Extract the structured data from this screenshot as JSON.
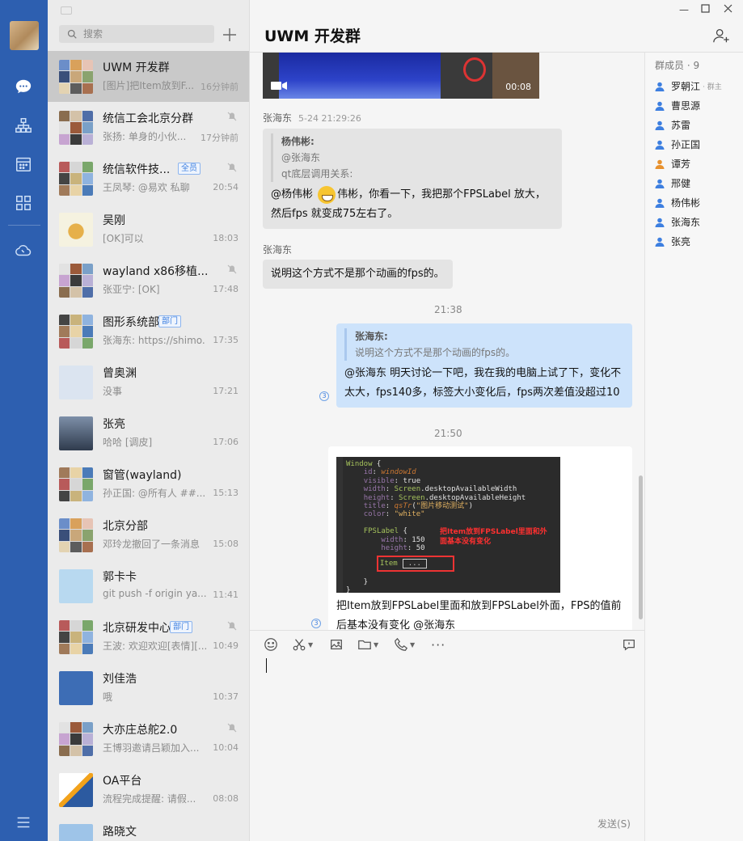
{
  "search": {
    "placeholder": "搜索"
  },
  "conversations": [
    {
      "name": "UWM 开发群",
      "preview": "[图片]把Item放到F...",
      "time": "16分钟前",
      "muted": false,
      "badge": ""
    },
    {
      "name": "统信工会北京分群",
      "preview": "张扬: 单身的小伙...",
      "time": "17分钟前",
      "muted": true,
      "badge": ""
    },
    {
      "name": "统信软件技...",
      "preview": "王凤琴: @易欢 私聊",
      "time": "20:54",
      "muted": true,
      "badge": "全员"
    },
    {
      "name": "吴刚",
      "preview": "[OK]可以",
      "time": "18:03",
      "muted": false,
      "badge": ""
    },
    {
      "name": "wayland  x86移植...",
      "preview": "张亚宁: [OK]",
      "time": "17:48",
      "muted": true,
      "badge": ""
    },
    {
      "name": "图形系统部",
      "preview": "张海东: https://shimo...",
      "time": "17:35",
      "muted": false,
      "badge": "部门"
    },
    {
      "name": "曾奥渊",
      "preview": "没事",
      "time": "17:21",
      "muted": false,
      "badge": ""
    },
    {
      "name": "张亮",
      "preview": "哈哈 [调皮]",
      "time": "17:06",
      "muted": false,
      "badge": ""
    },
    {
      "name": "窗管(wayland)",
      "preview": "孙正国: @所有人  ##...",
      "time": "15:13",
      "muted": false,
      "badge": ""
    },
    {
      "name": "北京分部",
      "preview": "邓玲龙撤回了一条消息",
      "time": "15:08",
      "muted": false,
      "badge": ""
    },
    {
      "name": "郭卡卡",
      "preview": "git push -f origin ya...",
      "time": "11:41",
      "muted": false,
      "badge": ""
    },
    {
      "name": "北京研发中心",
      "preview": "王波: 欢迎欢迎[表情][...",
      "time": "10:49",
      "muted": true,
      "badge": "部门"
    },
    {
      "name": "刘佳浩",
      "preview": "哦",
      "time": "10:37",
      "muted": false,
      "badge": ""
    },
    {
      "name": "大亦庄总舵2.0",
      "preview": "王博羽邀请吕颖加入...",
      "time": "10:04",
      "muted": true,
      "badge": ""
    },
    {
      "name": "OA平台",
      "preview": "流程完成提醒:  请假...",
      "time": "08:08",
      "muted": false,
      "badge": ""
    },
    {
      "name": "路晓文",
      "preview": "",
      "time": "",
      "muted": false,
      "badge": ""
    }
  ],
  "chat": {
    "title": "UWM 开发群",
    "video_duration": "00:08",
    "msg1": {
      "sender": "张海东",
      "time": "5-24 21:29:26",
      "quote_author": "杨伟彬:",
      "quote_line1": "@张海东",
      "quote_line2": "qt底层调用关系:",
      "text_a": "@杨伟彬 ",
      "text_b": "伟彬，你看一下，我把那个FPSLabel 放大，然后fps 就变成75左右了。"
    },
    "msg2": {
      "sender": "张海东",
      "text": "说明这个方式不是那个动画的fps的。"
    },
    "ts1": "21:38",
    "msg3": {
      "quote_author": "张海东:",
      "quote_text": "说明这个方式不是那个动画的fps的。",
      "text": "@张海东  明天讨论一下吧，我在我的电脑上试了下，变化不太大，fps140多，标签大小变化后，fps两次差值没超过10",
      "read_count": "3"
    },
    "ts2": "21:50",
    "msg4": {
      "code_note": "把Item放到FPSLabel里面和外面基本没有变化",
      "code_item": "Item",
      "code_item_box": "...",
      "text": "把Item放到FPSLabel里面和放到FPSLabel外面，FPS的值前后基本没有变化  @张海东",
      "read_count": "3"
    },
    "send_label": "发送(S)"
  },
  "members": {
    "title": "群成员 · 9",
    "list": [
      {
        "name": "罗朝江",
        "role": "· 群主",
        "color": "#3d7fe0"
      },
      {
        "name": "曹思源",
        "role": "",
        "color": "#3d7fe0"
      },
      {
        "name": "苏雷",
        "role": "",
        "color": "#3d7fe0"
      },
      {
        "name": "孙正国",
        "role": "",
        "color": "#3d7fe0"
      },
      {
        "name": "谭芳",
        "role": "",
        "color": "#e8912d"
      },
      {
        "name": "邢健",
        "role": "",
        "color": "#3d7fe0"
      },
      {
        "name": "杨伟彬",
        "role": "",
        "color": "#3d7fe0"
      },
      {
        "name": "张海东",
        "role": "",
        "color": "#3d7fe0"
      },
      {
        "name": "张亮",
        "role": "",
        "color": "#3d7fe0"
      }
    ]
  },
  "colors": {
    "rail": "#2d5fb0",
    "my_bubble": "#cde3fb",
    "accent": "#3d7fe0"
  }
}
